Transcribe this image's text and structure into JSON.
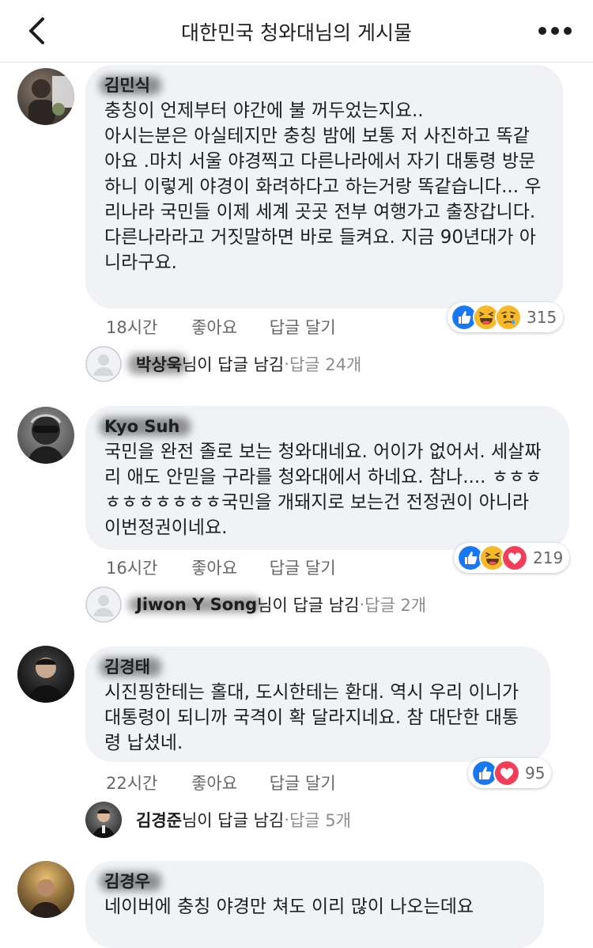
{
  "header": {
    "title": "대한민국 청와대님의 게시물"
  },
  "comments": [
    {
      "author": "김민식",
      "text": "충칭이 언제부터 야간에 불 꺼두었는지요..\n아시는분은 아실테지만 충칭 밤에 보통 저 사진하고 똑같아요 .마치 서울 야경찍고 다른나라에서 자기 대통령 방문하니 이렇게 야경이 화려하다고 하는거랑 똑같습니다... 우리나라 국민들 이제 세계 곳곳 전부 여행가고 출장갑니다.  다른나라라고 거짓말하면 바로 들켜요. 지금 90년대가 아니라구요.",
      "time": "18시간",
      "like": "좋아요",
      "reply": "답글 달기",
      "reactions": [
        "like",
        "haha",
        "sad"
      ],
      "reaction_count": "315",
      "reply_summary": {
        "name": "박상욱",
        "suffix": "님이 답글 남김",
        "dot": " · ",
        "count": "답글 24개"
      }
    },
    {
      "author": "Kyo Suh",
      "text": "국민을 완전 졸로 보는 청와대네요. 어이가 없어서. 세살짜리 애도 안믿을 구라를 청와대에서 하네요. 참나.... ㅎㅎㅎㅎㅎㅎㅎㅎㅎㅎ국민을 개돼지로 보는건 전정권이 아니라 이번정권이네요.",
      "time": "16시간",
      "like": "좋아요",
      "reply": "답글 달기",
      "reactions": [
        "like",
        "haha",
        "love"
      ],
      "reaction_count": "219",
      "reply_summary": {
        "name": "Jiwon Y Song",
        "suffix": "님이 답글 남김",
        "dot": " · ",
        "count": "답글 2개"
      }
    },
    {
      "author": "김경태",
      "text": "시진핑한테는 홀대, 도시한테는 환대. 역시 우리 이니가 대통령이 되니까 국격이 확 달라지네요. 참 대단한 대통령 납셨네.",
      "time": "22시간",
      "like": "좋아요",
      "reply": "답글 달기",
      "reactions": [
        "like",
        "love"
      ],
      "reaction_count": "95",
      "reply_summary": {
        "name": "김경준",
        "suffix": "님이 답글 남김",
        "dot": " · ",
        "count": "답글 5개"
      }
    },
    {
      "author": "김경우",
      "text": "네이버에 충칭 야경만 쳐도 이리 많이 나오는데요"
    }
  ],
  "colors": {
    "bubble": "#f0f2f5",
    "like_blue": "#1877f2",
    "love_red": "#f33e58",
    "haha_yellow": "#f7b928",
    "meta_gray": "#65676b"
  },
  "icons": {
    "back": "chevron-left-icon",
    "more": "more-dots-icon"
  }
}
